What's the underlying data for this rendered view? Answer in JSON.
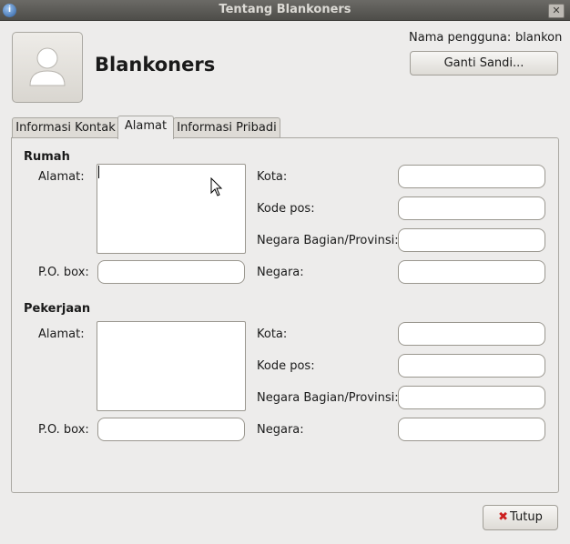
{
  "window": {
    "title": "Tentang Blankoners"
  },
  "header": {
    "user_title": "Blankoners",
    "username_label": "Nama pengguna:",
    "username_value": "blankon",
    "change_password_label": "Ganti Sandi..."
  },
  "tabs": [
    {
      "label": "Informasi Kontak",
      "active": false
    },
    {
      "label": "Alamat",
      "active": true
    },
    {
      "label": "Informasi Pribadi",
      "active": false
    }
  ],
  "home": {
    "heading": "Rumah",
    "address_label": "Alamat:",
    "pobox_label": "P.O. box:",
    "city_label": "Kota:",
    "postal_label": "Kode pos:",
    "state_label": "Negara Bagian/Provinsi:",
    "country_label": "Negara:",
    "address_value": "",
    "pobox_value": "",
    "city_value": "",
    "postal_value": "",
    "state_value": "",
    "country_value": ""
  },
  "work": {
    "heading": "Pekerjaan",
    "address_label": "Alamat:",
    "pobox_label": "P.O. box:",
    "city_label": "Kota:",
    "postal_label": "Kode pos:",
    "state_label": "Negara Bagian/Provinsi:",
    "country_label": "Negara:",
    "address_value": "",
    "pobox_value": "",
    "city_value": "",
    "postal_value": "",
    "state_value": "",
    "country_value": ""
  },
  "footer": {
    "close_label": "Tutup"
  },
  "icons": {
    "close": "close-icon",
    "avatar": "user-avatar-icon",
    "app": "app-icon",
    "pointer": "mouse-pointer-icon"
  }
}
